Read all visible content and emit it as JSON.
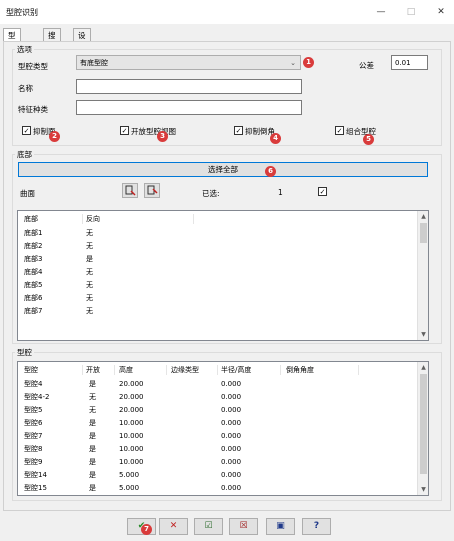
{
  "window": {
    "title": "型腔识别",
    "min": "—",
    "max": "□",
    "close": "✕"
  },
  "tabs": [
    {
      "label": "型腔范例"
    },
    {
      "label": "搜索"
    },
    {
      "label": "设置"
    }
  ],
  "options": {
    "group_label": "选项",
    "cavity_type_label": "型腔类型",
    "cavity_type_value": "有底型腔",
    "tolerance_label": "公差",
    "tolerance_value": "0.01",
    "name_label": "名称",
    "name_value": "",
    "feature_label": "特征种类",
    "feature_value": "",
    "checkboxes": [
      {
        "label": "抑制面",
        "checked": "✓"
      },
      {
        "label": "开放型腔视图",
        "checked": "✓"
      },
      {
        "label": "抑制倒角",
        "checked": "✓"
      },
      {
        "label": "组合型腔",
        "checked": "✓"
      }
    ]
  },
  "bottom_section": {
    "group_label": "底部",
    "select_all": "选择全部",
    "face_label": "曲面",
    "selected_label": "已选:",
    "selected_count": "1",
    "selected_check": "✓",
    "columns": [
      "底部",
      "反向"
    ],
    "rows": [
      [
        "底部1",
        "无"
      ],
      [
        "底部2",
        "无"
      ],
      [
        "底部3",
        "是"
      ],
      [
        "底部4",
        "无"
      ],
      [
        "底部5",
        "无"
      ],
      [
        "底部6",
        "无"
      ],
      [
        "底部7",
        "无"
      ]
    ]
  },
  "cavity_section": {
    "group_label": "型腔",
    "columns": [
      "型腔",
      "开放",
      "高度",
      "边缘类型",
      "半径/高度",
      "倒角角度"
    ],
    "rows": [
      [
        "型腔4",
        "是",
        "20.000",
        "",
        "0.000",
        ""
      ],
      [
        "型腔4-2",
        "无",
        "20.000",
        "",
        "0.000",
        ""
      ],
      [
        "型腔5",
        "无",
        "20.000",
        "",
        "0.000",
        ""
      ],
      [
        "型腔6",
        "是",
        "10.000",
        "",
        "0.000",
        ""
      ],
      [
        "型腔7",
        "是",
        "10.000",
        "",
        "0.000",
        ""
      ],
      [
        "型腔8",
        "是",
        "10.000",
        "",
        "0.000",
        ""
      ],
      [
        "型腔9",
        "是",
        "10.000",
        "",
        "0.000",
        ""
      ],
      [
        "型腔14",
        "是",
        "5.000",
        "",
        "0.000",
        ""
      ],
      [
        "型腔15",
        "是",
        "5.000",
        "",
        "0.000",
        ""
      ]
    ]
  },
  "badges": [
    "1",
    "2",
    "3",
    "4",
    "5",
    "6",
    "7"
  ],
  "footer_icons": [
    "ok-icon",
    "cancel-icon",
    "apply-icon",
    "reset-icon",
    "save-icon",
    "help-icon"
  ],
  "footer_glyphs": {
    "ok": "✔",
    "cancel": "✕",
    "apply": "☑",
    "reset": "☒",
    "save": "▣",
    "help": "?"
  },
  "colors": {
    "badge": "#d93b3b",
    "ok": "#2a8a2a",
    "cancel": "#c02020",
    "accent": "#0078d7"
  }
}
